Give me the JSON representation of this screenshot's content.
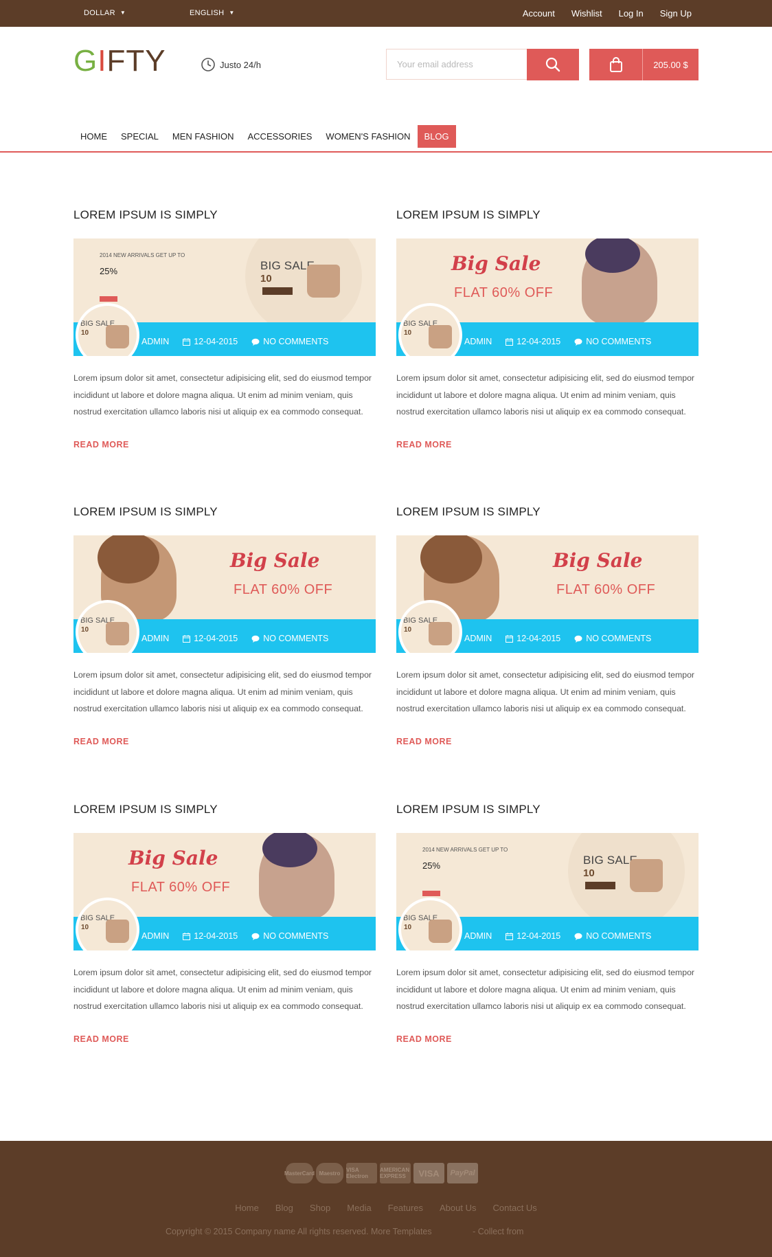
{
  "topbar": {
    "currency": "DOLLAR",
    "language": "ENGLISH",
    "links": [
      "Account",
      "Wishlist",
      "Log In",
      "Sign Up"
    ]
  },
  "header": {
    "logo_parts": [
      "G",
      "I",
      "FTY"
    ],
    "hours": "Justo 24/h",
    "email_placeholder": "Your email address",
    "cart_total": "205.00 $"
  },
  "nav": [
    "HOME",
    "SPECIAL",
    "MEN FASHION",
    "ACCESSORIES",
    "WOMEN'S FASHION",
    "BLOG"
  ],
  "colors": {
    "accent": "#df5a58",
    "brown": "#5c3d28",
    "cyan": "#1ec3ef",
    "banner": "#f5e8d6"
  },
  "banner_text": {
    "big_sale_script": "Big Sale",
    "flat_off": "FLAT 60% OFF",
    "new_arrivals": "2014 NEW ARRIVALS GET UP TO",
    "pct": "25%",
    "big_sale": "BIG SALE",
    "ten": "10"
  },
  "posts": [
    {
      "title": "LOREM IPSUM IS SIMPLY",
      "author": "ADMIN",
      "date": "12-04-2015",
      "comments": "NO COMMENTS",
      "excerpt": "Lorem ipsum dolor sit amet, consectetur adipisicing elit, sed do eiusmod tempor incididunt ut labore et dolore magna aliqua. Ut enim ad minim veniam, quis nostrud exercitation ullamco laboris nisi ut aliquip ex ea commodo consequat.",
      "read_more": "READ MORE"
    },
    {
      "title": "LOREM IPSUM IS SIMPLY",
      "author": "ADMIN",
      "date": "12-04-2015",
      "comments": "NO COMMENTS",
      "excerpt": "Lorem ipsum dolor sit amet, consectetur adipisicing elit, sed do eiusmod tempor incididunt ut labore et dolore magna aliqua. Ut enim ad minim veniam, quis nostrud exercitation ullamco laboris nisi ut aliquip ex ea commodo consequat.",
      "read_more": "READ MORE"
    },
    {
      "title": "LOREM IPSUM IS SIMPLY",
      "author": "ADMIN",
      "date": "12-04-2015",
      "comments": "NO COMMENTS",
      "excerpt": "Lorem ipsum dolor sit amet, consectetur adipisicing elit, sed do eiusmod tempor incididunt ut labore et dolore magna aliqua. Ut enim ad minim veniam, quis nostrud exercitation ullamco laboris nisi ut aliquip ex ea commodo consequat.",
      "read_more": "READ MORE"
    },
    {
      "title": "LOREM IPSUM IS SIMPLY",
      "author": "ADMIN",
      "date": "12-04-2015",
      "comments": "NO COMMENTS",
      "excerpt": "Lorem ipsum dolor sit amet, consectetur adipisicing elit, sed do eiusmod tempor incididunt ut labore et dolore magna aliqua. Ut enim ad minim veniam, quis nostrud exercitation ullamco laboris nisi ut aliquip ex ea commodo consequat.",
      "read_more": "READ MORE"
    },
    {
      "title": "LOREM IPSUM IS SIMPLY",
      "author": "ADMIN",
      "date": "12-04-2015",
      "comments": "NO COMMENTS",
      "excerpt": "Lorem ipsum dolor sit amet, consectetur adipisicing elit, sed do eiusmod tempor incididunt ut labore et dolore magna aliqua. Ut enim ad minim veniam, quis nostrud exercitation ullamco laboris nisi ut aliquip ex ea commodo consequat.",
      "read_more": "READ MORE"
    },
    {
      "title": "LOREM IPSUM IS SIMPLY",
      "author": "ADMIN",
      "date": "12-04-2015",
      "comments": "NO COMMENTS",
      "excerpt": "Lorem ipsum dolor sit amet, consectetur adipisicing elit, sed do eiusmod tempor incididunt ut labore et dolore magna aliqua. Ut enim ad minim veniam, quis nostrud exercitation ullamco laboris nisi ut aliquip ex ea commodo consequat.",
      "read_more": "READ MORE"
    }
  ],
  "footer": {
    "cards": [
      "MasterCard",
      "Maestro",
      "VISA Electron",
      "AMERICAN EXPRESS",
      "VISA",
      "PayPal"
    ],
    "links": [
      "Home",
      "Blog",
      "Shop",
      "Media",
      "Features",
      "About Us",
      "Contact Us"
    ],
    "copyright": "Copyright © 2015 Company name All rights reserved. More Templates",
    "collect": "- Collect from"
  }
}
